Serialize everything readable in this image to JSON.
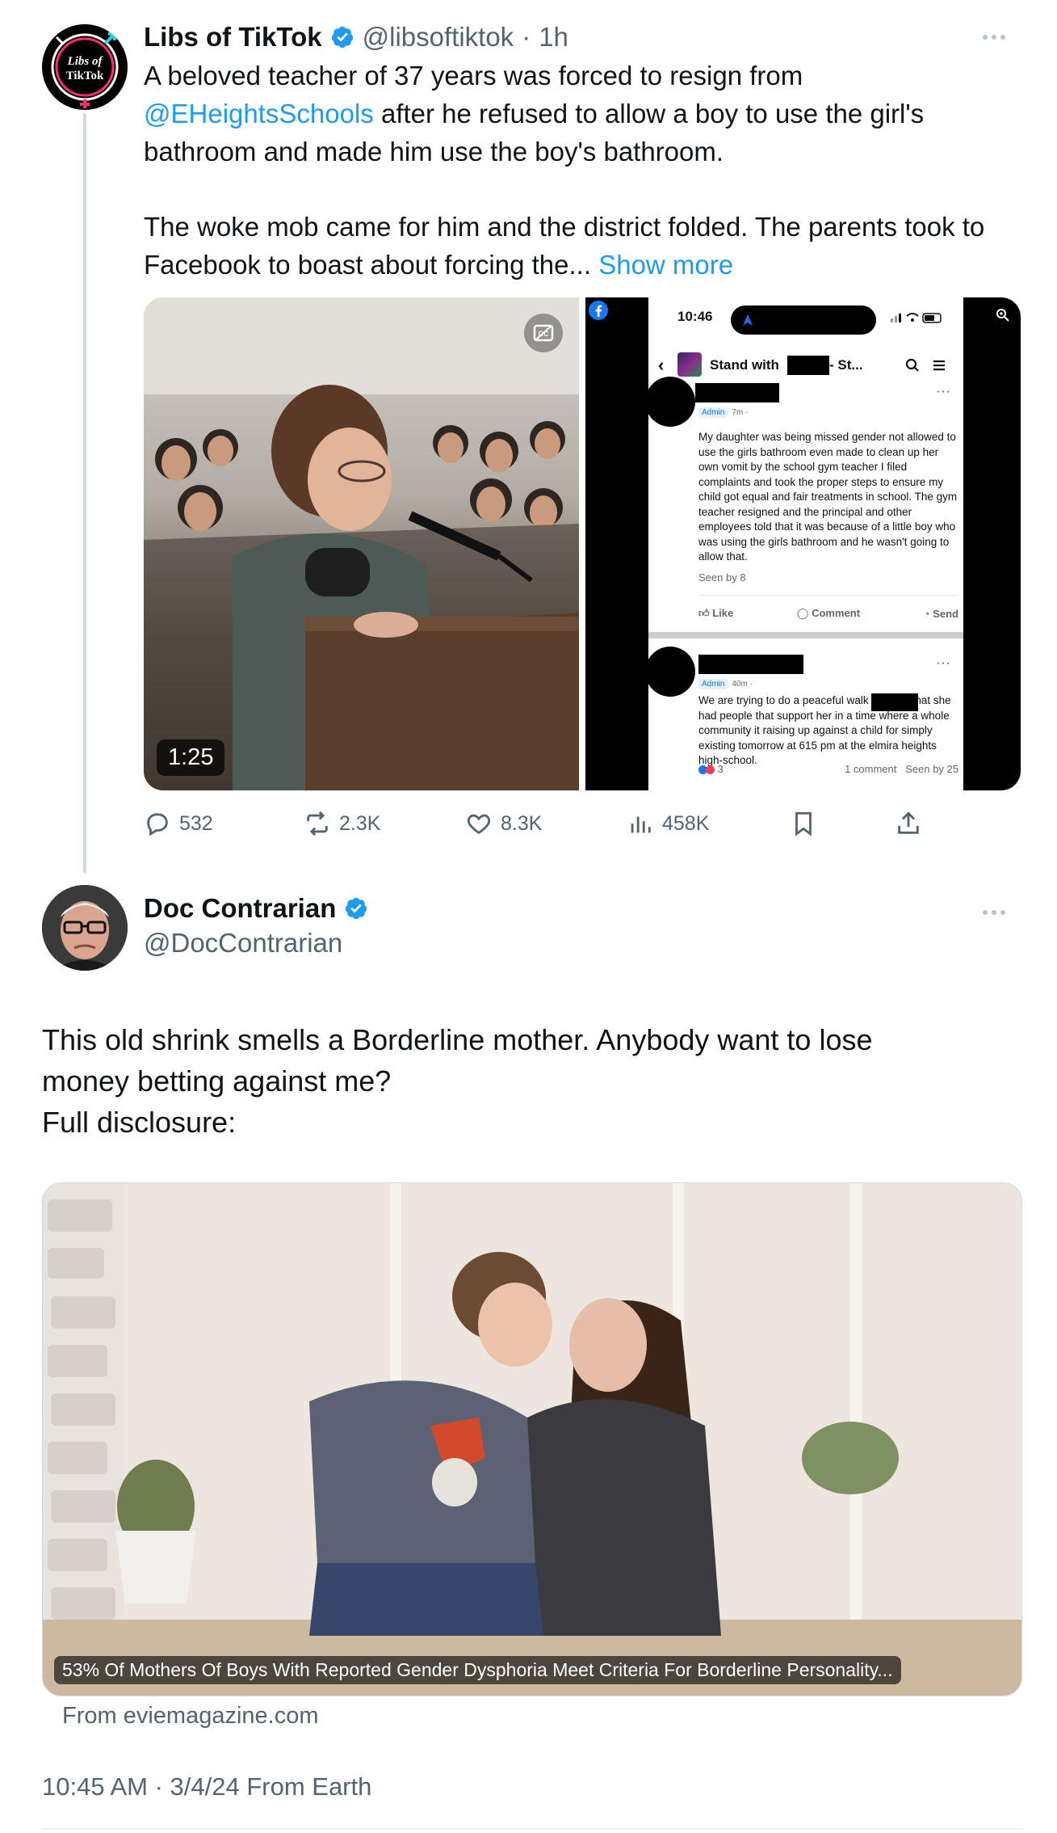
{
  "tweet1": {
    "name": "Libs of TikTok",
    "handle": "@libsoftiktok",
    "separator": "·",
    "time": "1h",
    "avatar_text_1": "Libs of",
    "avatar_text_2": "TikTok",
    "text_line1": "A beloved teacher of 37 years was forced to resign from",
    "mention": "@EHeightsSchools",
    "text_after_mention": " after he refused to allow a boy to use the girl's bathroom and made him use the boy's bathroom.",
    "text_para2": "The woke mob came for him and the district folded. The parents took to Facebook to boast about forcing the...",
    "show_more": "Show more",
    "video_duration": "1:25",
    "phone": {
      "time": "10:46",
      "group_name": "Stand with",
      "group_suffix": "- St...",
      "post1_meta": "Admin",
      "post1_time": "7m ·",
      "post1_text": "My daughter was being missed gender not allowed to use the girls bathroom even made to clean up her own vomit by the school gym teacher I filed complaints and took the proper steps to ensure my child got equal and fair treatments in school. The gym teacher resigned and the principal and other employees told that it was because of a little boy who was using the girls bathroom and he wasn't going to allow that.",
      "post1_seen": "Seen by 8",
      "like": "Like",
      "comment": "Comment",
      "send": "Send",
      "post2_meta": "Admin",
      "post2_time": "40m ·",
      "post2_text": "We are trying to do a peaceful walk to show that she had people that support her in a time where a whole community it raising up against a child for simply existing tomorrow at 615 pm at the elmira heights high-school.",
      "post2_reactions": "3",
      "post2_comments": "1 comment",
      "post2_seen": "Seen by 25"
    },
    "actions": {
      "replies": "532",
      "reposts": "2.3K",
      "likes": "8.3K",
      "views": "458K"
    }
  },
  "tweet2": {
    "name": "Doc Contrarian",
    "handle": "@DocContrarian",
    "text_line1": "This old shrink smells a Borderline mother. Anybody want to lose money betting against me?",
    "text_line2": "Full disclosure:",
    "card_title": "53% Of Mothers Of Boys With Reported Gender Dysphoria Meet Criteria For Borderline Personality...",
    "card_source": "From eviemagazine.com",
    "timestamp": "10:45 AM · 3/4/24 From Earth"
  },
  "colors": {
    "accent": "#1d9bf0",
    "text": "#0f1419",
    "secondary": "#536471"
  }
}
